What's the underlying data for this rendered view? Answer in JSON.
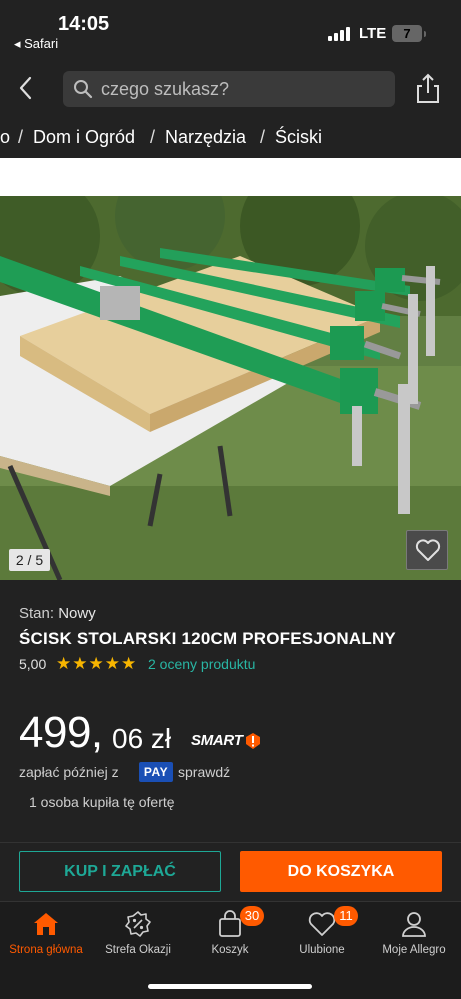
{
  "status_bar": {
    "time": "14:05",
    "back_app": "◂ Safari",
    "network": "LTE",
    "battery": "7"
  },
  "nav": {
    "search_placeholder": "czego szukasz?"
  },
  "breadcrumb": [
    "o",
    "Dom i Ogród",
    "Narzędzia",
    "Ściski"
  ],
  "gallery": {
    "counter": "2 / 5"
  },
  "product": {
    "condition_label": "Stan:",
    "condition_value": "Nowy",
    "title": "ŚCISK STOLARSKI 120CM PROFESJONALNY",
    "rating": "5,00",
    "stars": "★★★★★",
    "stars_value": 5,
    "reviews": "2 oceny produktu",
    "price_int": "499,",
    "price_dec": "06 zł",
    "smart": "SMART",
    "pay_later_prefix": "zapłać później z",
    "pay_badge": "PAY",
    "pay_later_suffix": "sprawdź",
    "bought": "1 osoba kupiła tę ofertę"
  },
  "actions": {
    "buy": "KUP I ZAPŁAĆ",
    "cart": "DO KOSZYKA"
  },
  "tabs": [
    {
      "label": "Strona główna",
      "icon": "home-icon"
    },
    {
      "label": "Strefa Okazji",
      "icon": "discount-icon"
    },
    {
      "label": "Koszyk",
      "icon": "cart-bag-icon",
      "badge": "30"
    },
    {
      "label": "Ulubione",
      "icon": "heart-icon",
      "badge": "11"
    },
    {
      "label": "Moje Allegro",
      "icon": "user-icon"
    }
  ],
  "colors": {
    "accent_orange": "#ff5a00",
    "accent_teal": "#1ea896",
    "star": "#f7b500",
    "pay_blue": "#1a4fb5"
  }
}
